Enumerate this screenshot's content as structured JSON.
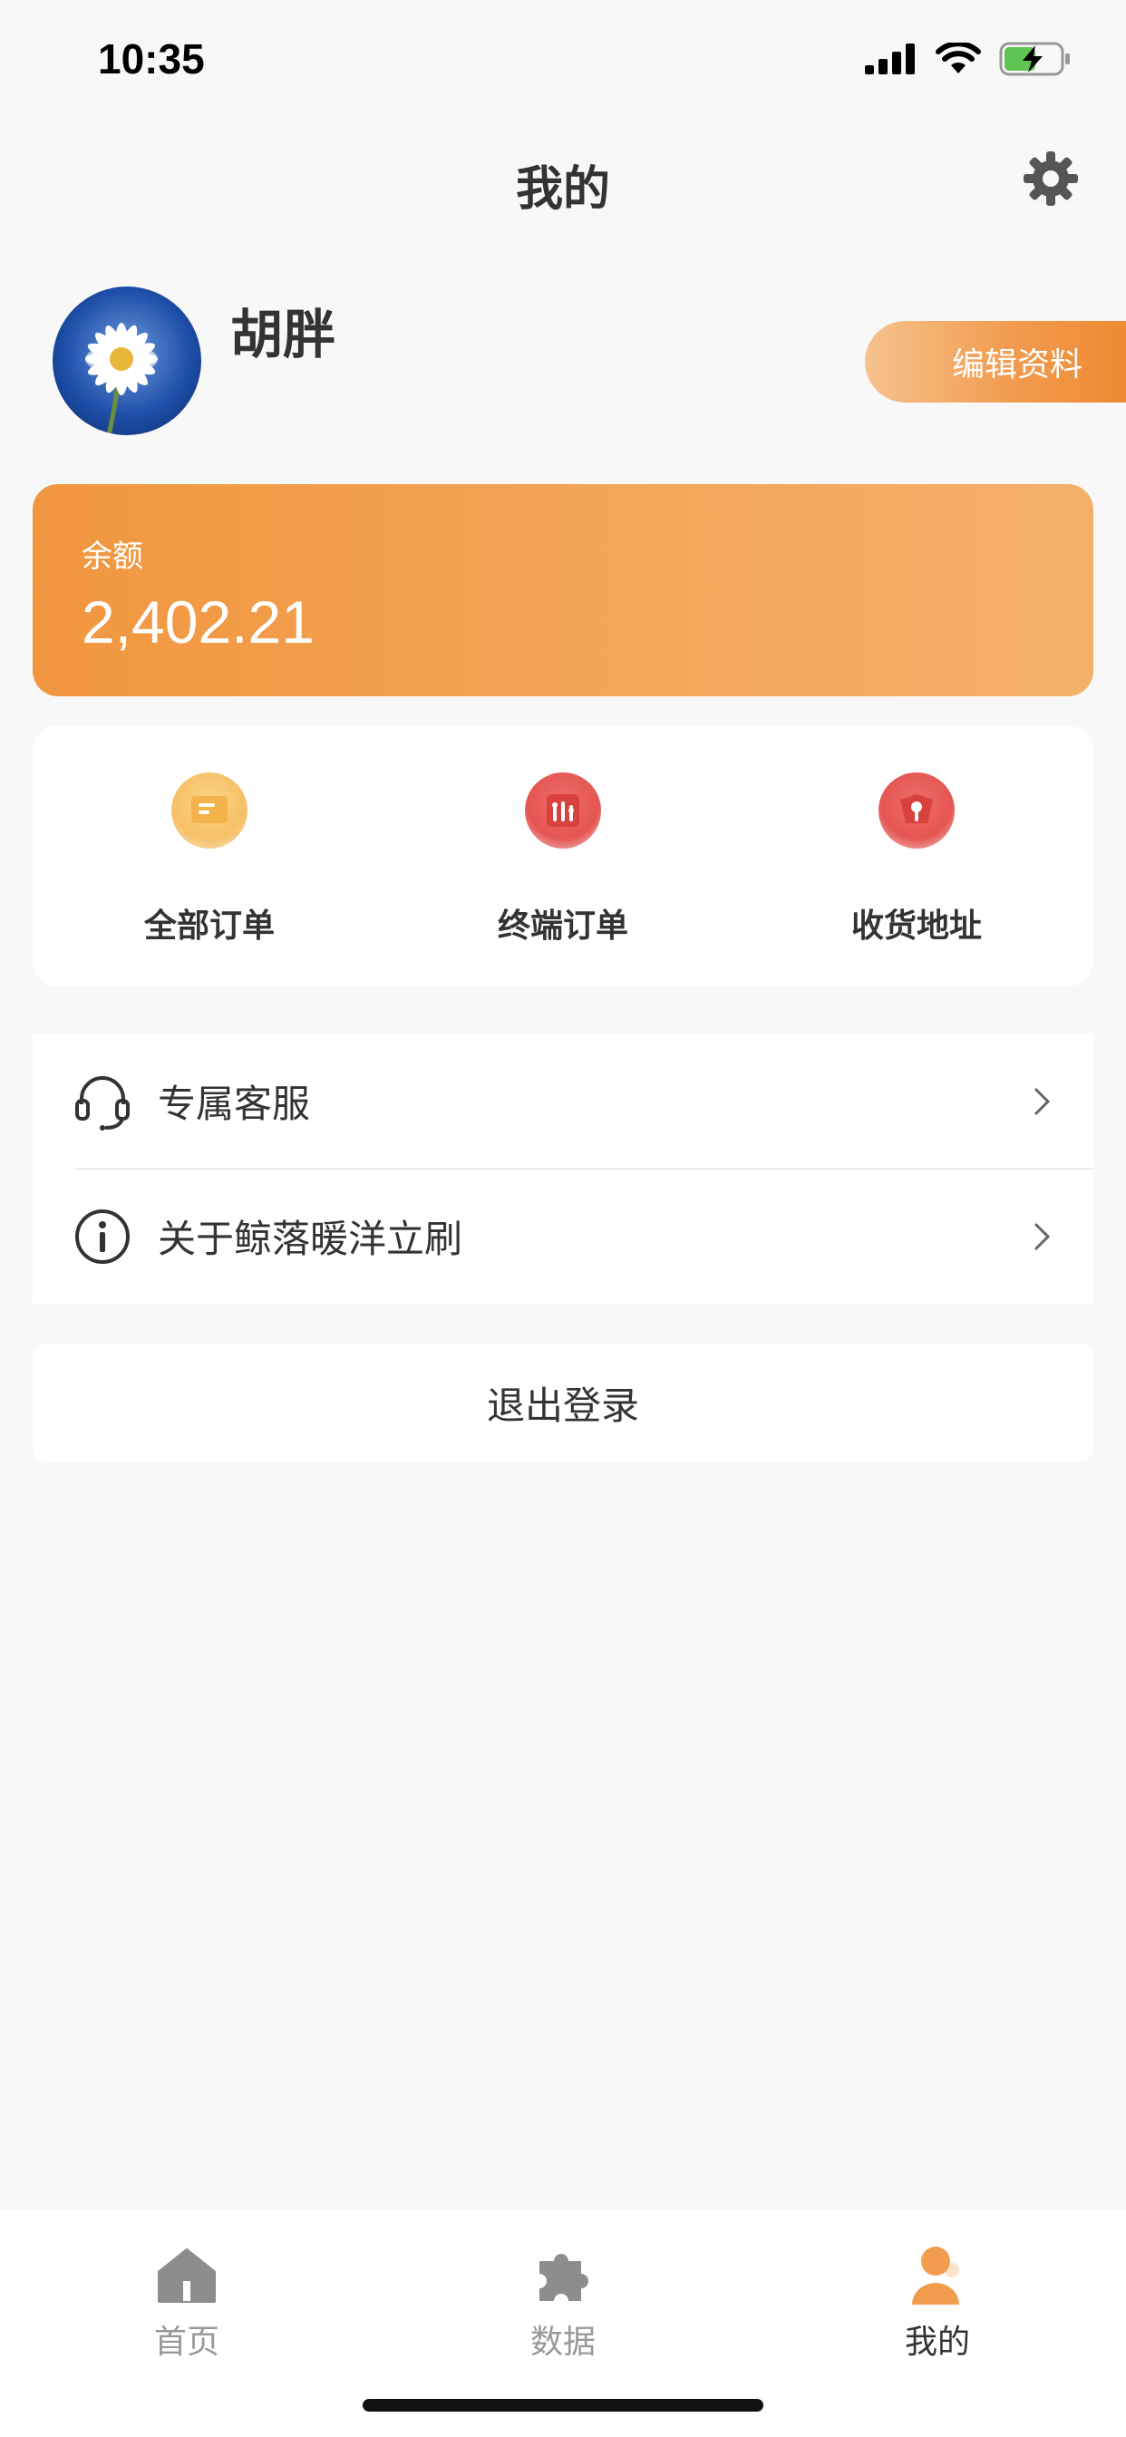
{
  "status_bar": {
    "time": "10:35"
  },
  "nav": {
    "title": "我的"
  },
  "profile": {
    "username": "胡胖",
    "edit_label": "编辑资料"
  },
  "balance": {
    "label": "余额",
    "value": "2,402.21"
  },
  "actions": [
    {
      "label": "全部订单",
      "icon": "orders-icon"
    },
    {
      "label": "终端订单",
      "icon": "terminal-icon"
    },
    {
      "label": "收货地址",
      "icon": "address-icon"
    }
  ],
  "menu": [
    {
      "label": "专属客服",
      "icon": "headset-icon"
    },
    {
      "label": "关于鲸落暖洋立刷",
      "icon": "info-icon"
    }
  ],
  "logout": {
    "label": "退出登录"
  },
  "tabbar": {
    "tabs": [
      {
        "label": "首页",
        "icon": "home-icon"
      },
      {
        "label": "数据",
        "icon": "puzzle-icon"
      },
      {
        "label": "我的",
        "icon": "user-icon"
      }
    ],
    "active_index": 2
  },
  "colors": {
    "accent": "#f29c4f",
    "accent_dark": "#ee8a33",
    "background": "#f8f8f8"
  }
}
